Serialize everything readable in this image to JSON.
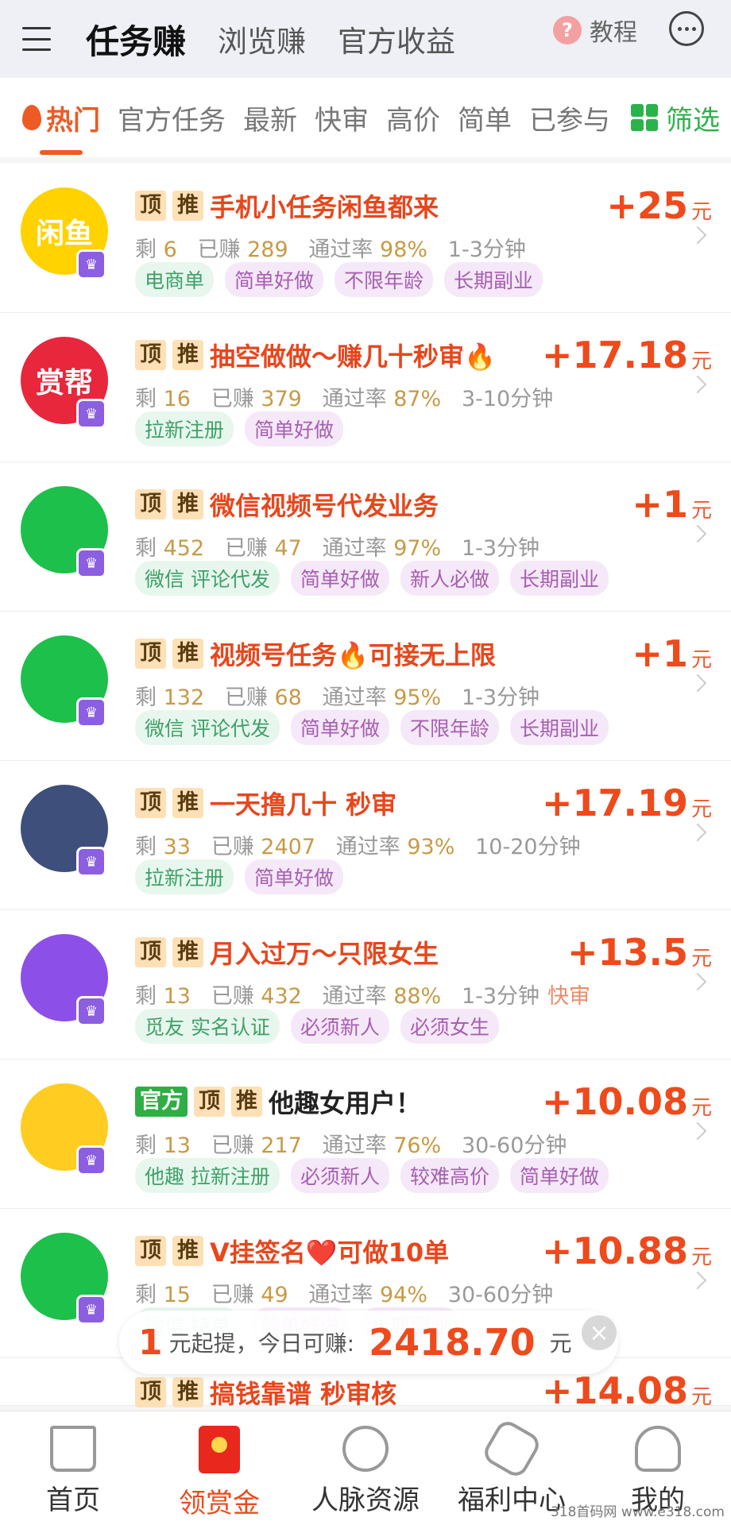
{
  "header": {
    "tabs": [
      "任务赚",
      "浏览赚",
      "官方收益"
    ],
    "tutorial": "教程",
    "question_mark": "?"
  },
  "categories": [
    "热门",
    "官方任务",
    "最新",
    "快审",
    "高价",
    "简单",
    "已参与"
  ],
  "filter_label": "筛选",
  "badges": {
    "official": "官方",
    "top": "顶",
    "push": "推"
  },
  "tasks": [
    {
      "avatar_text": "闲鱼",
      "avatar_color": "#ffd200",
      "title": "手机小任务闲鱼都来",
      "remaining": "6",
      "earned": "289",
      "pass_rate": "98%",
      "duration": "1-3分钟",
      "reward": "+25",
      "unit": "元",
      "labels": [
        {
          "t": "电商单",
          "c": "g"
        },
        {
          "t": "简单好做",
          "c": "p"
        },
        {
          "t": "不限年龄",
          "c": "p"
        },
        {
          "t": "长期副业",
          "c": "p"
        }
      ]
    },
    {
      "avatar_text": "赏帮",
      "avatar_color": "#e8263c",
      "title": "抽空做做～赚几十秒审🔥",
      "remaining": "16",
      "earned": "379",
      "pass_rate": "87%",
      "duration": "3-10分钟",
      "reward": "+17.18",
      "unit": "元",
      "labels": [
        {
          "t": "拉新注册",
          "c": "g"
        },
        {
          "t": "简单好做",
          "c": "p"
        }
      ]
    },
    {
      "avatar_text": "",
      "avatar_color": "#1dc04a",
      "title": "微信视频号代发业务",
      "remaining": "452",
      "earned": "47",
      "pass_rate": "97%",
      "duration": "1-3分钟",
      "reward": "+1",
      "unit": "元",
      "labels": [
        {
          "t": "微信 评论代发",
          "c": "g"
        },
        {
          "t": "简单好做",
          "c": "p"
        },
        {
          "t": "新人必做",
          "c": "p"
        },
        {
          "t": "长期副业",
          "c": "p"
        }
      ]
    },
    {
      "avatar_text": "",
      "avatar_color": "#1dc04a",
      "title": "视频号任务🔥可接无上限",
      "remaining": "132",
      "earned": "68",
      "pass_rate": "95%",
      "duration": "1-3分钟",
      "reward": "+1",
      "unit": "元",
      "labels": [
        {
          "t": "微信 评论代发",
          "c": "g"
        },
        {
          "t": "简单好做",
          "c": "p"
        },
        {
          "t": "不限年龄",
          "c": "p"
        },
        {
          "t": "长期副业",
          "c": "p"
        }
      ]
    },
    {
      "avatar_text": "",
      "avatar_color": "#3d4f7a",
      "title": "一天撸几十 秒审",
      "remaining": "33",
      "earned": "2407",
      "pass_rate": "93%",
      "duration": "10-20分钟",
      "reward": "+17.19",
      "unit": "元",
      "labels": [
        {
          "t": "拉新注册",
          "c": "g"
        },
        {
          "t": "简单好做",
          "c": "p"
        }
      ]
    },
    {
      "avatar_text": "",
      "avatar_color": "#8c4fe8",
      "title": "月入过万～只限女生",
      "remaining": "13",
      "earned": "432",
      "pass_rate": "88%",
      "duration": "1-3分钟",
      "fast": "快审",
      "reward": "+13.5",
      "unit": "元",
      "labels": [
        {
          "t": "觅友 实名认证",
          "c": "g"
        },
        {
          "t": "必须新人",
          "c": "p"
        },
        {
          "t": "必须女生",
          "c": "p"
        }
      ]
    },
    {
      "avatar_text": "",
      "avatar_color": "#ffcc22",
      "official": true,
      "title": "他趣女用户！",
      "remaining": "13",
      "earned": "217",
      "pass_rate": "76%",
      "duration": "30-60分钟",
      "reward": "+10.08",
      "unit": "元",
      "labels": [
        {
          "t": "他趣 拉新注册",
          "c": "g"
        },
        {
          "t": "必须新人",
          "c": "p"
        },
        {
          "t": "较难高价",
          "c": "p"
        },
        {
          "t": "简单好做",
          "c": "p"
        }
      ]
    },
    {
      "avatar_text": "",
      "avatar_color": "#1dc04a",
      "title": "V挂签名❤️可做10单",
      "remaining": "15",
      "earned": "49",
      "pass_rate": "94%",
      "duration": "30-60分钟",
      "reward": "+10.88",
      "unit": "元",
      "labels": [
        {
          "t": "微信 特单",
          "c": "g"
        },
        {
          "t": "简单好做",
          "c": "p"
        },
        {
          "t": "长期副业",
          "c": "p"
        }
      ]
    }
  ],
  "stat_labels": {
    "remaining": "剩",
    "earned": "已赚",
    "pass_rate": "通过率"
  },
  "partial_task": {
    "title": "搞钱靠谱 秒审核",
    "reward": "+14.08",
    "unit": "元"
  },
  "banner": {
    "min": "1",
    "text1": "元起提，今日可赚:",
    "amount": "2418.70",
    "unit": "元"
  },
  "bottom_nav": [
    "首页",
    "领赏金",
    "人脉资源",
    "福利中心",
    "我的"
  ],
  "watermark": "318首码网 www.e318.com"
}
